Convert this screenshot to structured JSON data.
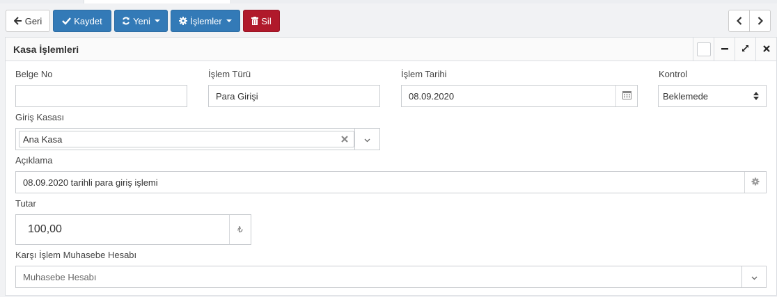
{
  "toolbar": {
    "back_label": "Geri",
    "save_label": "Kaydet",
    "new_label": "Yeni",
    "actions_label": "İşlemler",
    "delete_label": "Sil"
  },
  "panel": {
    "title": "Kasa İşlemleri"
  },
  "form": {
    "belge_no": {
      "label": "Belge No",
      "value": ""
    },
    "islem_turu": {
      "label": "İşlem Türü",
      "value": "Para Girişi"
    },
    "islem_tarihi": {
      "label": "İşlem Tarihi",
      "value": "08.09.2020"
    },
    "kontrol": {
      "label": "Kontrol",
      "value": "Beklemede"
    },
    "giris_kasasi": {
      "label": "Giriş Kasası",
      "value": "Ana Kasa"
    },
    "aciklama": {
      "label": "Açıklama",
      "value": "08.09.2020 tarihli para giriş işlemi"
    },
    "tutar": {
      "label": "Tutar",
      "value": "100,00",
      "currency_symbol": "₺"
    },
    "karsi_hesap": {
      "label": "Karşı İşlem Muhasebe Hesabı",
      "placeholder": "Muhasebe Hesabı"
    }
  },
  "colors": {
    "primary": "#337ab7",
    "danger": "#b0192b"
  }
}
